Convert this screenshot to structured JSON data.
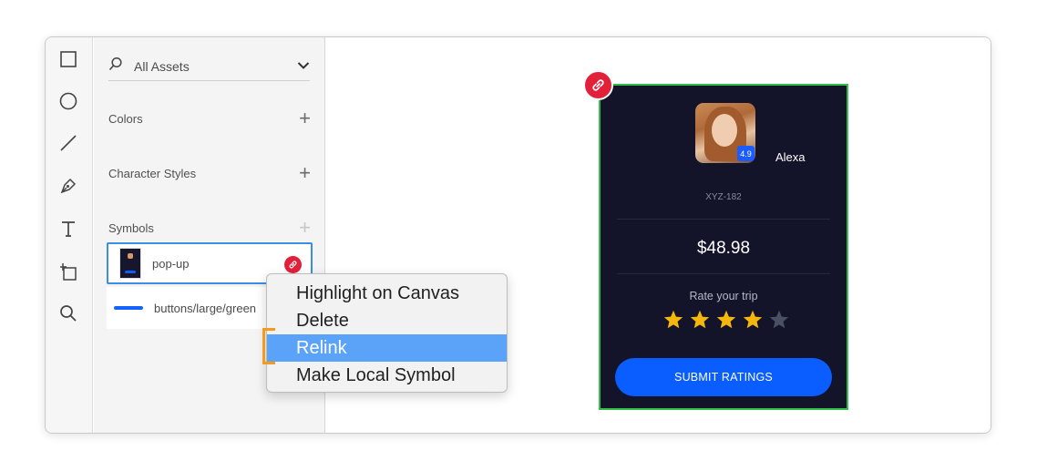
{
  "assets_panel": {
    "search_label": "All Assets",
    "sections": {
      "colors": "Colors",
      "character_styles": "Character Styles",
      "symbols": "Symbols"
    },
    "symbols": [
      {
        "name": "pop-up",
        "linked": true,
        "selected": true
      },
      {
        "name": "buttons/large/green",
        "linked": false,
        "selected": false
      }
    ]
  },
  "artboard": {
    "rating_chip": "4.9",
    "person_name": "Alexa",
    "code": "XYZ-182",
    "price": "$48.98",
    "rate_label": "Rate your trip",
    "stars_filled": 4,
    "stars_total": 5,
    "submit_label": "SUBMIT RATINGS"
  },
  "context_menu": {
    "items": [
      {
        "label": "Highlight on Canvas",
        "highlighted": false
      },
      {
        "label": "Delete",
        "highlighted": false
      },
      {
        "label": "Relink",
        "highlighted": true
      },
      {
        "label": "Make Local Symbol",
        "highlighted": false
      }
    ]
  },
  "colors": {
    "link_badge": "#e2203a",
    "accent_blue": "#0a5dff",
    "selection_green": "#2fbf47",
    "menu_highlight": "#5aa3f9",
    "callout_orange": "#f39b1f",
    "star_filled": "#f5b60d",
    "star_empty": "#4a5064"
  },
  "icons": [
    "rectangle-icon",
    "ellipse-icon",
    "line-icon",
    "pen-icon",
    "text-icon",
    "artboard-icon",
    "zoom-icon",
    "search-icon",
    "chevron-down-icon",
    "link-icon",
    "star-icon"
  ]
}
